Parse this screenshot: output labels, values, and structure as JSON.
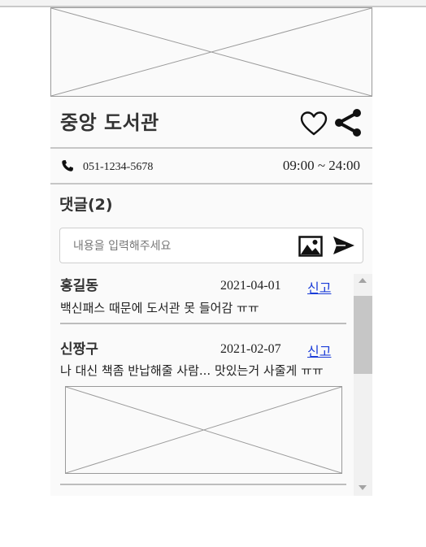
{
  "place": {
    "name": "중앙 도서관",
    "phone": "051-1234-5678",
    "hours": "09:00 ~ 24:00"
  },
  "icons": {
    "favorite": "heart-outline-icon",
    "share": "share-icon",
    "phone": "phone-icon",
    "attach_image": "image-icon",
    "send": "send-icon"
  },
  "comments": {
    "title": "댓글(2)",
    "input_placeholder": "내용을 입력해주세요",
    "input_value": "",
    "items": [
      {
        "author": "홍길동",
        "date": "2021-04-01",
        "report_label": "신고",
        "text": "백신패스 때문에 도서관 못 들어감 ㅠㅠ"
      },
      {
        "author": "신짱구",
        "date": "2021-02-07",
        "report_label": "신고",
        "text": "나 대신 책좀 반납해줄 사람... 맛있는거 사줄게 ㅠㅠ"
      }
    ]
  },
  "colors": {
    "link": "#1a3cd8",
    "divider": "#c6c6c6",
    "card_bg": "#fafafa"
  }
}
